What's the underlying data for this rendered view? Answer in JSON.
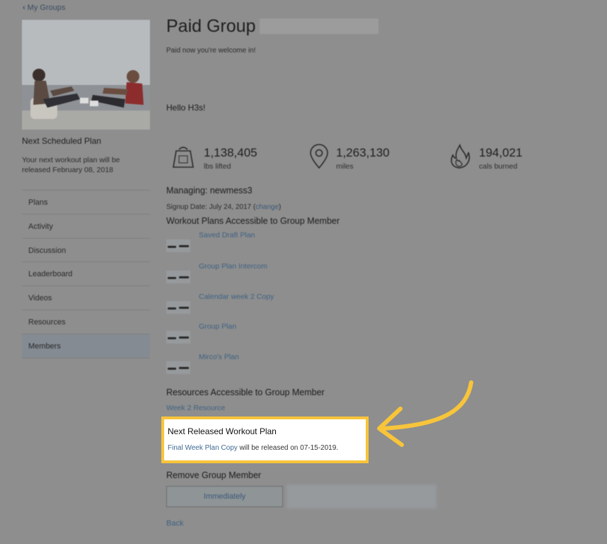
{
  "nav": {
    "back_label": "My Groups"
  },
  "sidebar": {
    "next_plan_title": "Next Scheduled Plan",
    "next_plan_text": "Your next workout plan will be released February 08, 2018",
    "items": [
      {
        "label": "Plans"
      },
      {
        "label": "Activity"
      },
      {
        "label": "Discussion"
      },
      {
        "label": "Leaderboard"
      },
      {
        "label": "Videos"
      },
      {
        "label": "Resources"
      },
      {
        "label": "Members",
        "active": true
      }
    ]
  },
  "main": {
    "title": "Paid Group",
    "subtitle": "Paid now you're welcome in!",
    "greeting": "Hello H3s!",
    "stats": [
      {
        "value": "1,138,405",
        "label": "lbs lifted",
        "icon": "weight-icon"
      },
      {
        "value": "1,263,130",
        "label": "miles",
        "icon": "location-pin-icon"
      },
      {
        "value": "194,021",
        "label": "cals burned",
        "icon": "flame-icon"
      }
    ],
    "managing": "Managing: newmess3",
    "signup_prefix": "Signup Date: July 24, 2017 (",
    "signup_change": "change",
    "signup_suffix": ")",
    "plans_heading": "Workout Plans Accessible to Group Member",
    "plans": [
      {
        "name": "Saved Draft Plan"
      },
      {
        "name": "Group Plan Intercom"
      },
      {
        "name": "Calendar week 2 Copy"
      },
      {
        "name": "Group Plan"
      },
      {
        "name": "Mirco's Plan"
      }
    ],
    "resources_heading": "Resources Accessible to Group Member",
    "resource_link": "Week 2 Resource",
    "next_release": {
      "heading": "Next Released Workout Plan",
      "plan_link": "Final Week Plan Copy",
      "text": " will be released on 07-15-2019."
    },
    "remove_heading": "Remove Group Member",
    "remove_immediately": "Immediately",
    "back_label": "Back"
  },
  "colors": {
    "highlight": "#f8c43a",
    "link": "#3f6282"
  }
}
